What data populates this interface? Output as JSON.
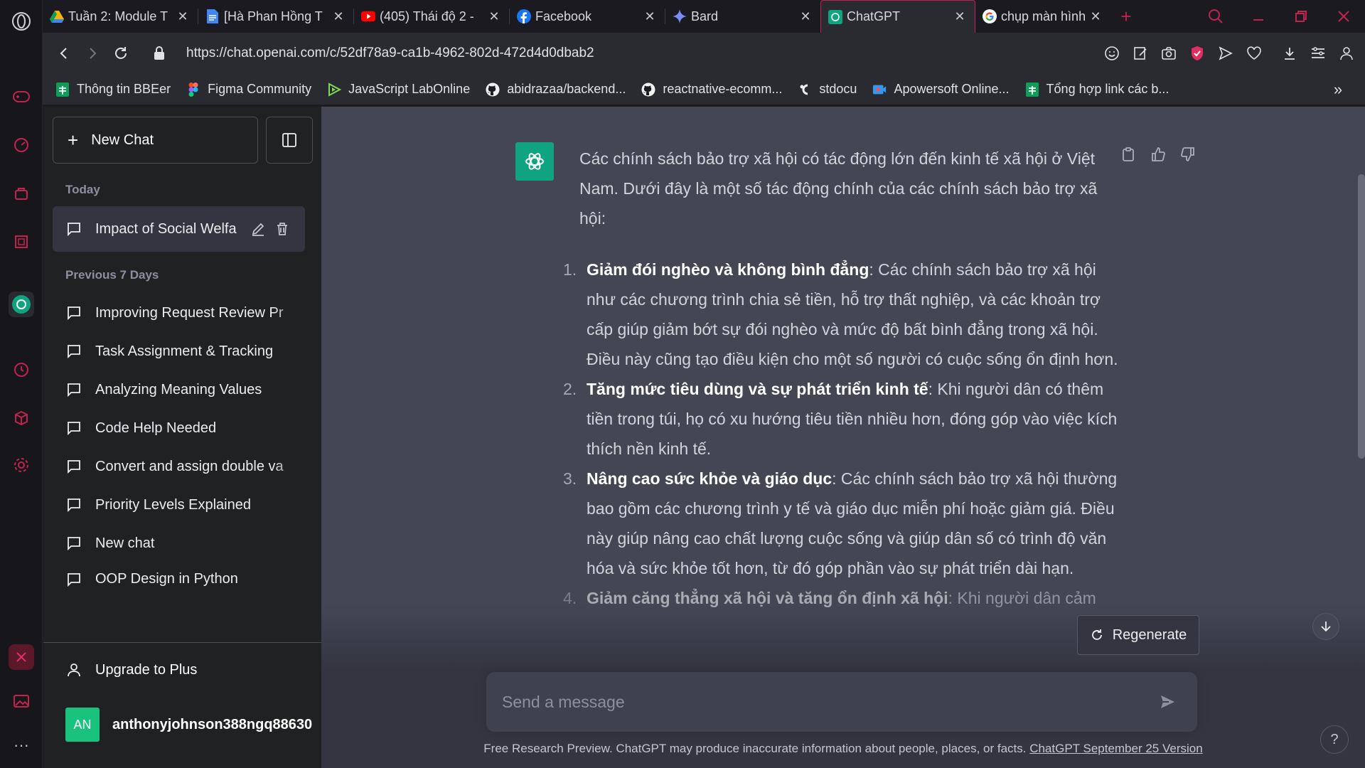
{
  "browser": {
    "tabs": [
      {
        "title": "Tuần 2: Module T",
        "icon": "google-drive-icon"
      },
      {
        "title": "[Hà Phan Hồng T",
        "icon": "google-docs-icon"
      },
      {
        "title": "(405) Thái độ 2 -",
        "icon": "youtube-icon"
      },
      {
        "title": "Facebook",
        "icon": "facebook-icon"
      },
      {
        "title": "Bard",
        "icon": "bard-icon"
      },
      {
        "title": "ChatGPT",
        "icon": "chatgpt-icon",
        "active": true
      },
      {
        "title": "chụp màn hình d",
        "icon": "google-icon"
      }
    ],
    "url": "https://chat.openai.com/c/52df78a9-ca1b-4962-802d-472d4d0dbab2",
    "bookmarks": [
      {
        "label": "Thông tin BBEer",
        "icon": "sheets-icon"
      },
      {
        "label": "Figma Community",
        "icon": "figma-icon"
      },
      {
        "label": "JavaScript LabOnline",
        "icon": "play-icon"
      },
      {
        "label": "abidrazaa/backend...",
        "icon": "github-icon"
      },
      {
        "label": "reactnative-ecomm...",
        "icon": "github-icon"
      },
      {
        "label": "stdocu",
        "icon": "studocu-icon"
      },
      {
        "label": "Apowersoft Online...",
        "icon": "apowersoft-icon"
      },
      {
        "label": "Tổng hợp link các b...",
        "icon": "sheets-icon"
      }
    ],
    "accent_color": "#c2234e"
  },
  "sidebar": {
    "new_chat_label": "New Chat",
    "today_label": "Today",
    "active_conversation": "Impact of Social Welfa",
    "previous_label": "Previous 7 Days",
    "conversations": [
      "Improving Request Review Pr",
      "Task Assignment & Tracking",
      "Analyzing Meaning Values",
      "Code Help Needed",
      "Convert and assign double va",
      "Priority Levels Explained",
      "New chat",
      "OOP Design in Python"
    ],
    "upgrade_label": "Upgrade to Plus",
    "user_initials": "AN",
    "user_name": "anthonyjohnson388ngq88630!"
  },
  "chat": {
    "intro": "Các chính sách bảo trợ xã hội có tác động lớn đến kinh tế xã hội ở Việt Nam. Dưới đây là một số tác động chính của các chính sách bảo trợ xã hội:",
    "items": [
      {
        "num": "1.",
        "bold": "Giảm đói nghèo và không bình đẳng",
        "text": ": Các chính sách bảo trợ xã hội như các chương trình chia sẻ tiền, hỗ trợ thất nghiệp, và các khoản trợ cấp giúp giảm bớt sự đói nghèo và mức độ bất bình đẳng trong xã hội. Điều này cũng tạo điều kiện cho một số người có cuộc sống ổn định hơn."
      },
      {
        "num": "2.",
        "bold": "Tăng mức tiêu dùng và sự phát triển kinh tế",
        "text": ": Khi người dân có thêm tiền trong túi, họ có xu hướng tiêu tiền nhiều hơn, đóng góp vào việc kích thích nền kinh tế."
      },
      {
        "num": "3.",
        "bold": "Nâng cao sức khỏe và giáo dục",
        "text": ": Các chính sách bảo trợ xã hội thường bao gồm các chương trình y tế và giáo dục miễn phí hoặc giảm giá. Điều này giúp nâng cao chất lượng cuộc sống và giúp dân số có trình độ văn hóa và sức khỏe tốt hơn, từ đó góp phần vào sự phát triển dài hạn."
      },
      {
        "num": "4.",
        "bold": "Giảm căng thẳng xã hội và tăng ổn định xã hội",
        "text": ": Khi người dân cảm"
      }
    ],
    "regenerate_label": "Regenerate",
    "input_placeholder": "Send a message",
    "footer_text": "Free Research Preview. ChatGPT may produce inaccurate information about people, places, or facts. ",
    "footer_link": "ChatGPT September 25 Version",
    "help_label": "?"
  }
}
